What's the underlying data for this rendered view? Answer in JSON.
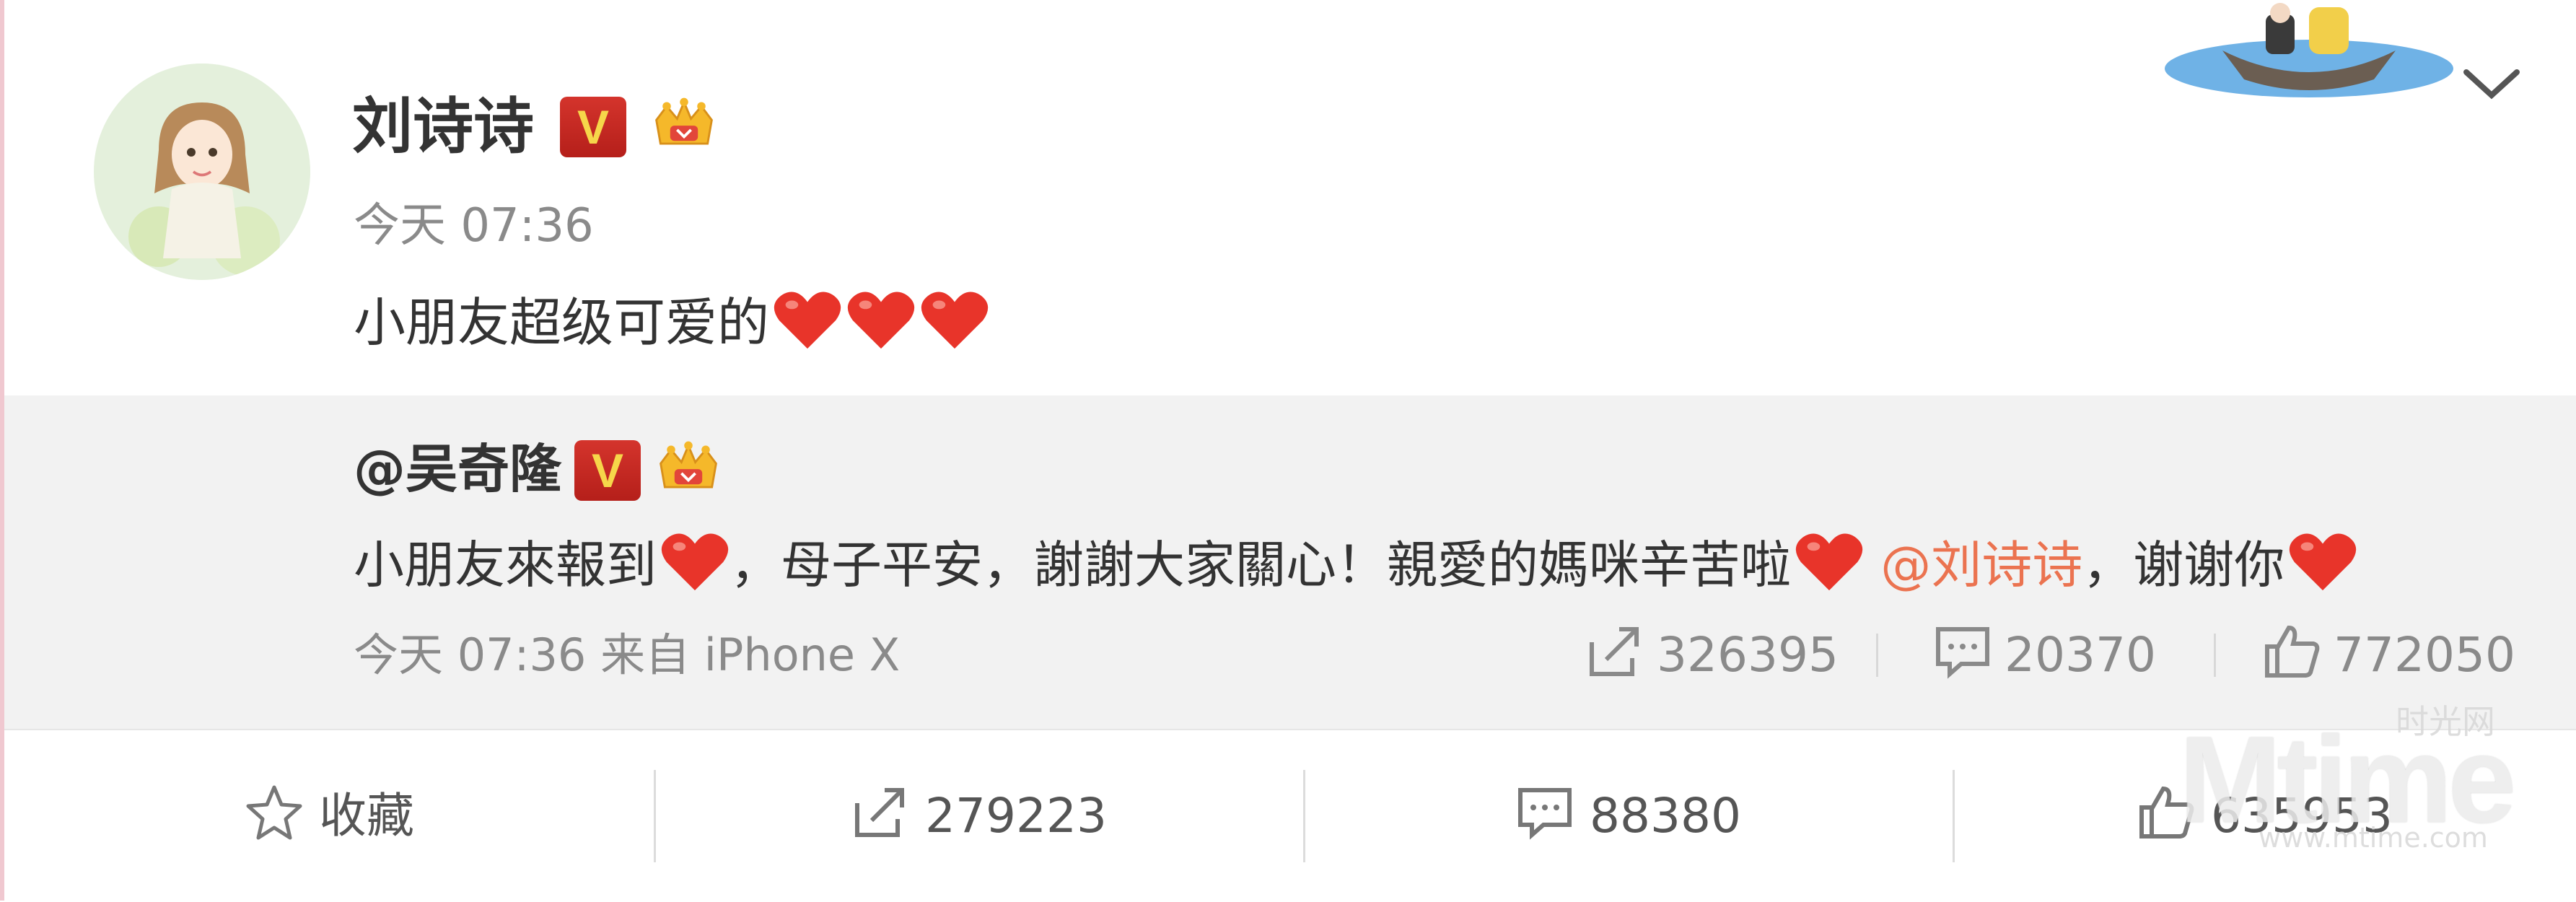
{
  "post": {
    "author_name": "刘诗诗",
    "verified_badge": "V",
    "time": "今天 07:36",
    "text": "小朋友超级可爱的",
    "heart_count": 3
  },
  "repost": {
    "author": "@吴奇隆",
    "verified_badge": "V",
    "text_part1": "小朋友來報到",
    "text_part2": "，母子平安，謝謝大家關心！親愛的媽咪辛苦啦",
    "mention": "@刘诗诗",
    "text_part3": "，谢谢你",
    "meta": "今天 07:36 来自 iPhone X",
    "stats": {
      "forwards": "326395",
      "comments": "20370",
      "likes": "772050"
    }
  },
  "actions": {
    "favorite_label": "收藏",
    "forward_count": "279223",
    "comment_count": "88380",
    "like_count": "635953"
  },
  "watermark": {
    "logo": "Mtime",
    "cn_text": "时光网",
    "url": "www.mtime.com"
  },
  "icons": {
    "expand": "chevron-down-icon",
    "forward": "share-arrow-icon",
    "comment": "comment-icon",
    "like": "thumbs-up-icon",
    "favorite": "star-icon",
    "heart": "red-heart-emoji"
  },
  "colors": {
    "mention": "#eb7350",
    "badge_red": "#c8261f",
    "badge_letter": "#f6d64a",
    "heart": "#e8342a",
    "repost_bg": "#f2f2f2"
  }
}
